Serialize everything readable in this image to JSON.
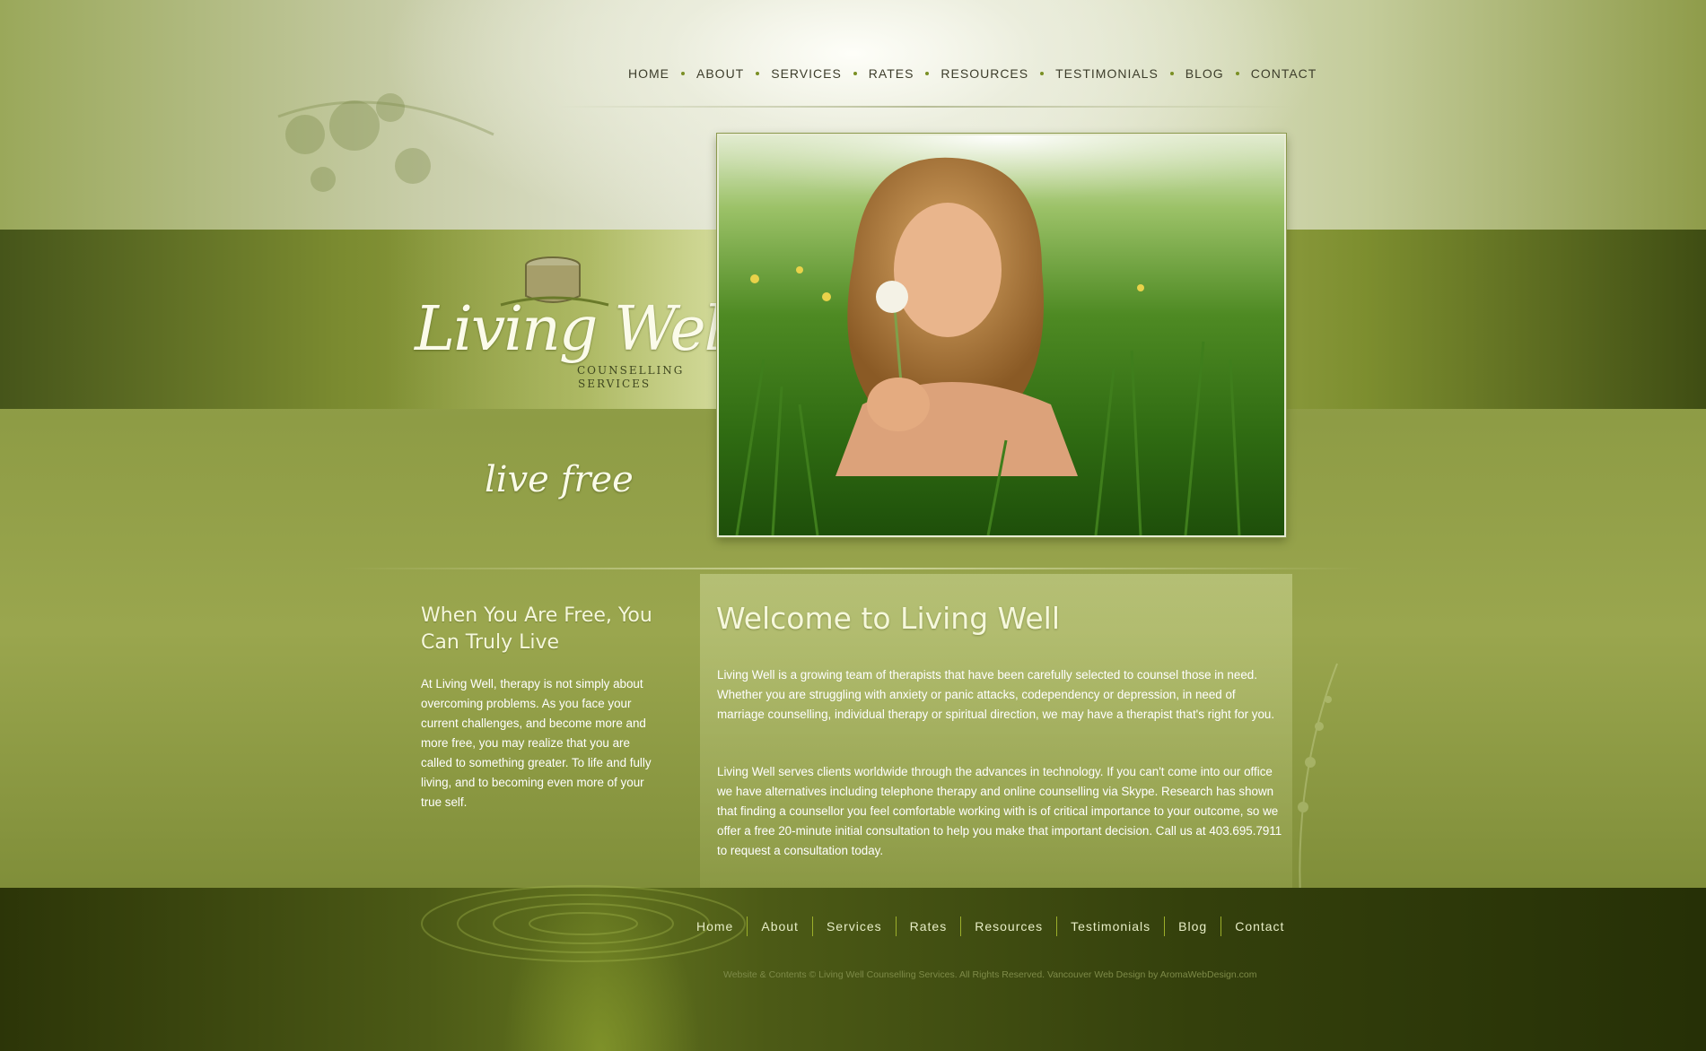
{
  "nav": {
    "items": [
      "HOME",
      "ABOUT",
      "SERVICES",
      "RATES",
      "RESOURCES",
      "TESTIMONIALS",
      "BLOG",
      "CONTACT"
    ]
  },
  "logo": {
    "name": "Living Well",
    "subtitle_line1": "COUNSELLING",
    "subtitle_line2": "SERVICES"
  },
  "tagline": "live free",
  "sidebar": {
    "title": "When You Are Free, You Can Truly Live",
    "text": "At Living Well, therapy is not simply about overcoming problems. As you face your current challenges, and become more and more free, you may realize that you are called to something greater. To life and fully living, and to becoming even more of your true self."
  },
  "main": {
    "title": "Welcome to Living Well",
    "paragraph1": "Living Well is a growing team of therapists that have been carefully selected to counsel those in need.  Whether you are struggling with anxiety or panic attacks, codependency or depression, in need of marriage counselling, individual therapy or spiritual direction, we may have a therapist that's right for you.",
    "paragraph2": "Living Well serves clients worldwide through the advances in technology.  If you can't come into our office we have alternatives including telephone therapy and online counselling via Skype. Research has shown that finding a counsellor you feel comfortable working with is of critical importance to your outcome, so we offer a free 20-minute initial consultation to help you make that important decision.  Call us at 403.695.7911 to request a consultation today."
  },
  "footer": {
    "nav": [
      "Home",
      "About",
      "Services",
      "Rates",
      "Resources",
      "Testimonials",
      "Blog",
      "Contact"
    ],
    "copyright": "Website & Contents © Living Well Counselling Services. All Rights Reserved. Vancouver Web Design by AromaWebDesign.com"
  },
  "colors": {
    "accent": "#7a8f24",
    "footer_separator": "#9caf2b"
  }
}
